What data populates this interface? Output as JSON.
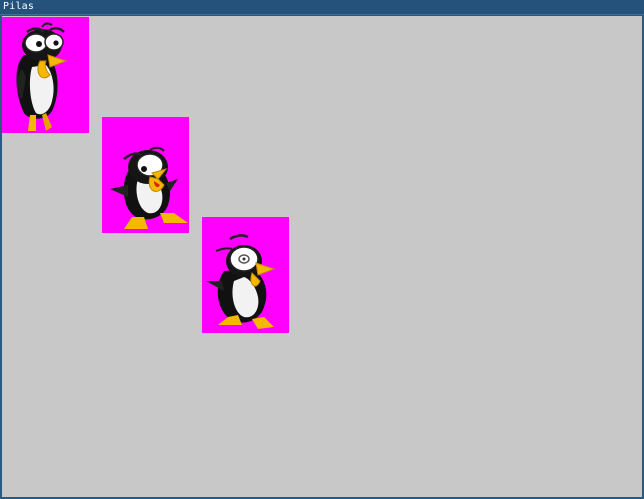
{
  "window": {
    "title": "Pilas"
  },
  "colors": {
    "titlebar": "#24527a",
    "canvas_background": "#c8c8c8",
    "sprite_background": "#ff00ff"
  },
  "actors": [
    {
      "name": "penguin-actor-1",
      "icon": "penguin-looking-up"
    },
    {
      "name": "penguin-actor-2",
      "icon": "penguin-shouting"
    },
    {
      "name": "penguin-actor-3",
      "icon": "penguin-turning"
    }
  ]
}
